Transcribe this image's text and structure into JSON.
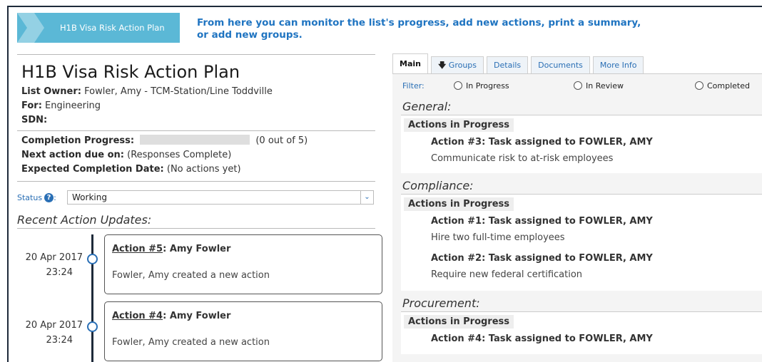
{
  "header": {
    "crumb_label": "H1B Visa Risk Action Plan",
    "message": "From here you can monitor the list's progress, add new actions, print a summary, or add new groups."
  },
  "plan": {
    "title": "H1B Visa Risk Action Plan",
    "owner_label": "List Owner:",
    "owner_value": "Fowler, Amy - TCM-Station/Line Toddville",
    "for_label": "For:",
    "for_value": "Engineering",
    "sdn_label": "SDN:",
    "sdn_value": "",
    "progress_label": "Completion Progress:",
    "progress_text": "(0 out of 5)",
    "progress_fraction": 0,
    "next_label": "Next action due on:",
    "next_value": "(Responses Complete)",
    "expected_label": "Expected Completion Date:",
    "expected_value": "(No actions yet)"
  },
  "status": {
    "label": "Status",
    "help_glyph": "?",
    "value": "Working",
    "arrow_glyph": "⌄"
  },
  "recent": {
    "heading": "Recent Action Updates:",
    "items": [
      {
        "date": "20 Apr 2017",
        "time": "23:24",
        "link": "Action #5",
        "author": ": Amy Fowler",
        "body": "Fowler, Amy created a new action"
      },
      {
        "date": "20 Apr 2017",
        "time": "23:24",
        "link": "Action #4",
        "author": ": Amy Fowler",
        "body": "Fowler, Amy created a new action"
      }
    ]
  },
  "tabs": [
    {
      "label": "Main",
      "active": true
    },
    {
      "label": "Groups",
      "icon": "down-arrow-icon"
    },
    {
      "label": "Details"
    },
    {
      "label": "Documents"
    },
    {
      "label": "More Info"
    }
  ],
  "filter": {
    "label": "Filter:",
    "options": [
      "In Progress",
      "In Review",
      "Completed"
    ]
  },
  "groups": [
    {
      "name": "General:",
      "subheading": "Actions in Progress",
      "actions": [
        {
          "title": "Action #3: Task assigned to FOWLER, AMY",
          "desc": "Communicate risk to at-risk employees"
        }
      ]
    },
    {
      "name": "Compliance:",
      "subheading": "Actions in Progress",
      "actions": [
        {
          "title": "Action #1: Task assigned to FOWLER, AMY",
          "desc": "Hire two full-time employees"
        },
        {
          "title": "Action #2: Task assigned to FOWLER, AMY",
          "desc": "Require new federal certification"
        }
      ]
    },
    {
      "name": "Procurement:",
      "subheading": "Actions in Progress",
      "actions": [
        {
          "title": "Action #4: Task assigned to FOWLER, AMY",
          "desc": ""
        }
      ]
    }
  ],
  "colors": {
    "crumb": "#5bb8d6",
    "accent": "#1f74c1",
    "frame": "#1e2a3a"
  }
}
